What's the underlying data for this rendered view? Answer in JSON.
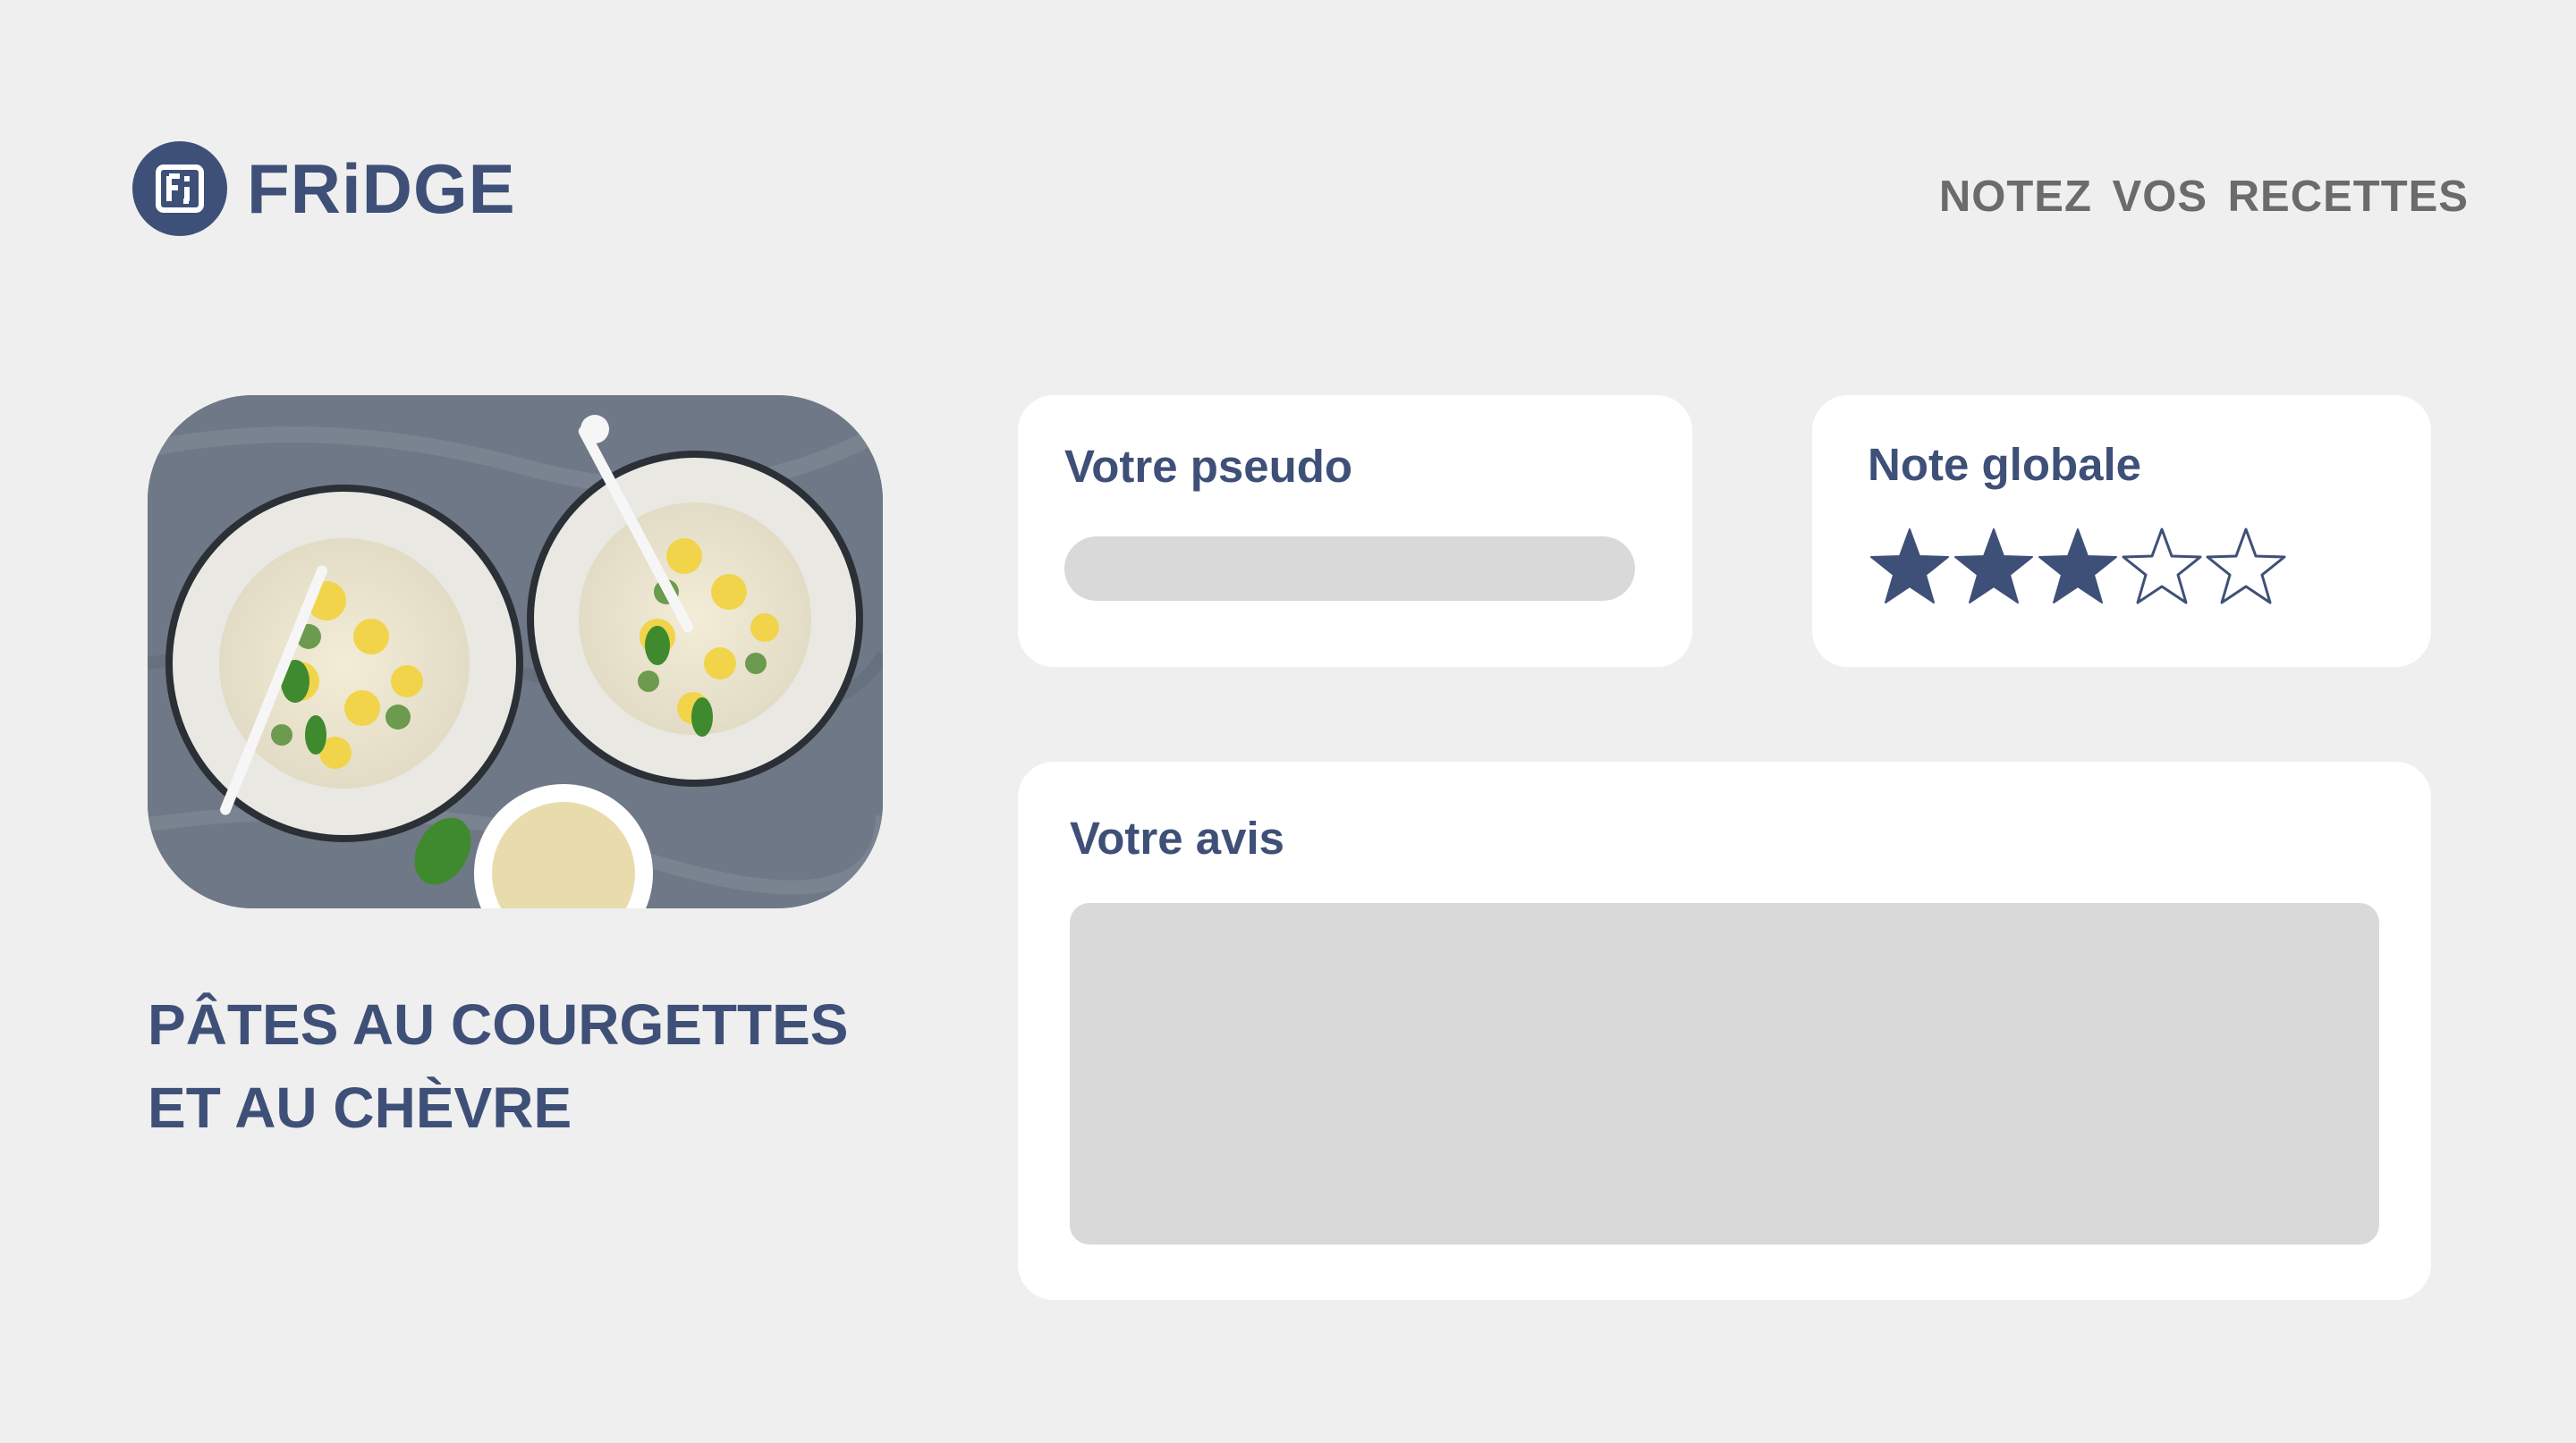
{
  "brand": {
    "name": "FRiDGE",
    "logo_icon": "fridge-logo-icon",
    "color": "#3f5078"
  },
  "header": {
    "tagline": "NOTEZ VOS  RECETTES"
  },
  "recipe": {
    "image_icon": "pasta-dish-photo",
    "title_line1": "PÂTES AU COURGETTES",
    "title_line2": "ET AU CHÈVRE"
  },
  "form": {
    "pseudo_label": "Votre pseudo",
    "pseudo_value": "",
    "note_label": "Note globale",
    "rating": {
      "value": 3,
      "max": 5
    },
    "avis_label": "Votre avis",
    "avis_value": ""
  },
  "colors": {
    "accent": "#3f5078",
    "background": "#efefef",
    "field": "#d9d9d9",
    "card": "#ffffff",
    "tagline": "#6b6b6b"
  }
}
